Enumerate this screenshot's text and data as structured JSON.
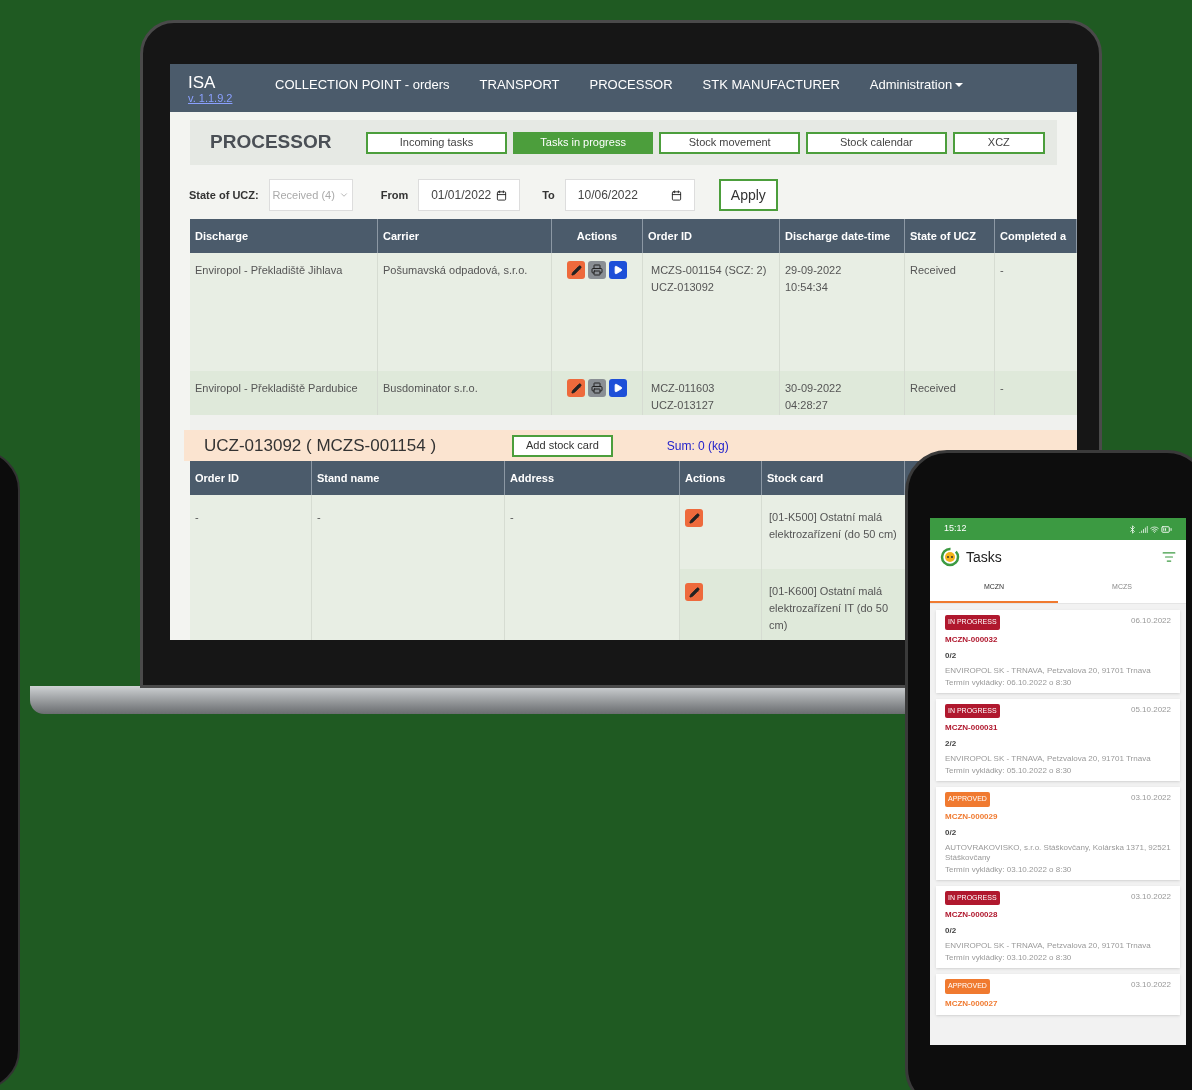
{
  "laptop": {
    "nav": {
      "brand": "ISA",
      "version": "v. 1.1.9.2",
      "items": [
        {
          "label": "COLLECTION POINT - orders",
          "dropdown": false
        },
        {
          "label": "TRANSPORT",
          "dropdown": false
        },
        {
          "label": "PROCESSOR",
          "dropdown": false
        },
        {
          "label": "STK MANUFACTURER",
          "dropdown": false
        },
        {
          "label": "Administration",
          "dropdown": true
        }
      ]
    },
    "page_title": "PROCESSOR",
    "tabs": [
      {
        "label": "Incoming tasks",
        "selected": false
      },
      {
        "label": "Tasks in progress",
        "selected": true
      },
      {
        "label": "Stock movement",
        "selected": false
      },
      {
        "label": "Stock calendar",
        "selected": false
      },
      {
        "label": "XCZ",
        "selected": false
      }
    ],
    "filters": {
      "state_label": "State of UCZ:",
      "state_value": "Received (4)",
      "from_label": "From",
      "from_value": "01/01/2022",
      "to_label": "To",
      "to_value": "10/06/2022",
      "apply": "Apply"
    },
    "tasks_table": {
      "columns": [
        "Discharge",
        "Carrier",
        "Actions",
        "Order ID",
        "Discharge date-time",
        "State of UCZ",
        "Completed a"
      ],
      "rows": [
        {
          "discharge": "Enviropol - Překladiště Jihlava",
          "carrier": "Pošumavská odpadová, s.r.o.",
          "order_id": [
            "MCZS-001154  (SCZ: 2)",
            "UCZ-013092"
          ],
          "datetime": [
            "29-09-2022",
            "10:54:34"
          ],
          "state": "Received",
          "completed": "-"
        },
        {
          "discharge": "Enviropol - Překladiště Pardubice",
          "carrier": "Busdominator s.r.o.",
          "order_id": [
            "MCZ-011603",
            "UCZ-013127"
          ],
          "datetime": [
            "30-09-2022",
            "04:28:27"
          ],
          "state": "Received",
          "completed": "-"
        }
      ]
    },
    "detail": {
      "title": "UCZ-013092 ( MCZS-001154 )",
      "add_button": "Add stock card",
      "sum": "Sum: 0 (kg)",
      "columns": [
        "Order ID",
        "Stand name",
        "Address",
        "Actions",
        "Stock card"
      ],
      "rows": [
        {
          "order_id": "-",
          "stand_name": "-",
          "address": "-",
          "stock_cards": [
            "[01-K500] Ostatní malá elektrozařízení (do 50 cm)",
            "[01-K600] Ostatní malá elektrozařízení IT (do 50 cm)"
          ]
        }
      ]
    }
  },
  "phone": {
    "time": "15:12",
    "title": "Tasks",
    "tabs": [
      {
        "label": "MCZN",
        "selected": true
      },
      {
        "label": "MCZS",
        "selected": false
      }
    ],
    "tasks": [
      {
        "status": "IN PROGRESS",
        "color": "#b0182e",
        "date": "06.10.2022",
        "id": "MCZN-000032",
        "count": "0/2",
        "address": "ENVIROPOL SK - TRNAVA, Petzvalova 20, 91701 Trnava",
        "term": "Termín vykládky: 06.10.2022 o 8:30"
      },
      {
        "status": "IN PROGRESS",
        "color": "#b0182e",
        "date": "05.10.2022",
        "id": "MCZN-000031",
        "count": "2/2",
        "address": "ENVIROPOL SK - TRNAVA, Petzvalova 20, 91701 Trnava",
        "term": "Termín vykládky: 05.10.2022 o 8:30"
      },
      {
        "status": "APPROVED",
        "color": "#f07a30",
        "date": "03.10.2022",
        "id": "MCZN-000029",
        "count": "0/2",
        "address": "AUTOVRAKOVISKO, s.r.o. Stáškovčany, Kolárska 1371, 92521 Stáškovčany",
        "term": "Termín vykládky: 03.10.2022 o 8:30"
      },
      {
        "status": "IN PROGRESS",
        "color": "#b0182e",
        "date": "03.10.2022",
        "id": "MCZN-000028",
        "count": "0/2",
        "address": "ENVIROPOL SK - TRNAVA, Petzvalova 20, 91701 Trnava",
        "term": "Termín vykládky: 03.10.2022 o 8:30"
      },
      {
        "status": "APPROVED",
        "color": "#f07a30",
        "date": "03.10.2022",
        "id": "MCZN-000027"
      }
    ]
  }
}
